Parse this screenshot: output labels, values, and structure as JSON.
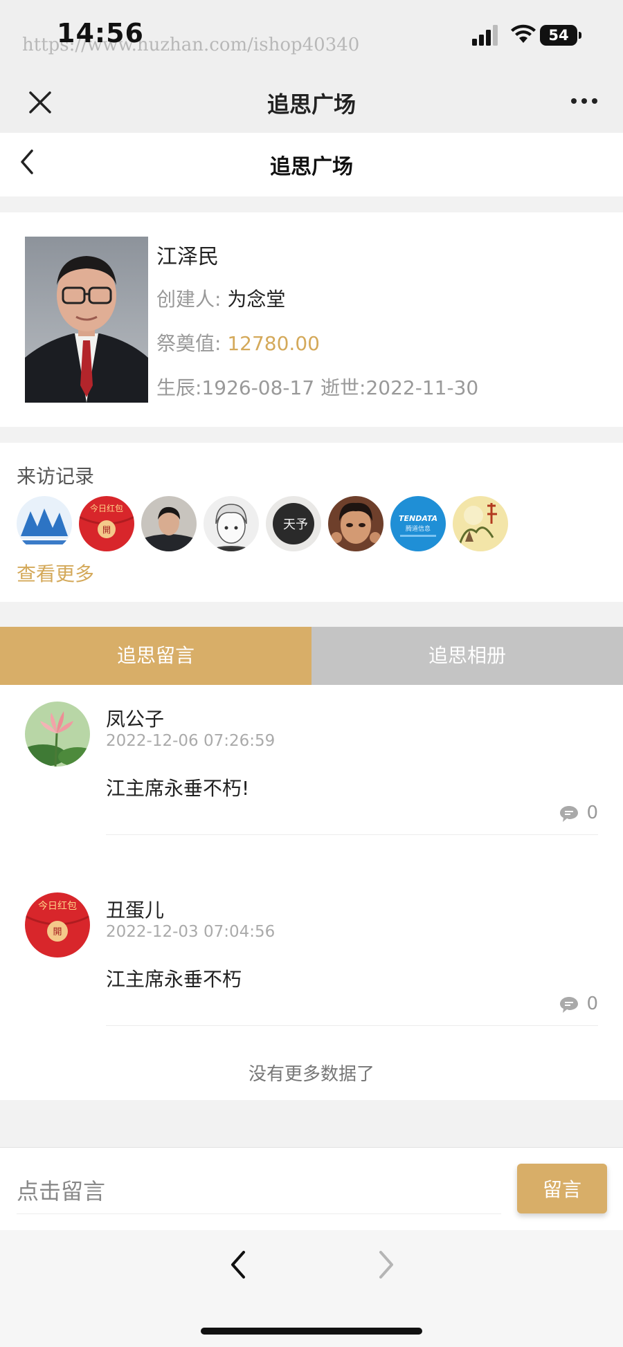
{
  "status_bar": {
    "time": "14:56",
    "watermark": "https://www.huzhan.com/ishop40340",
    "battery": "54"
  },
  "wechat_bar": {
    "title": "追思广场"
  },
  "page_nav": {
    "title": "追思广场"
  },
  "profile": {
    "name": "江泽民",
    "creator_label": "创建人:",
    "creator_value": "为念堂",
    "value_label": "祭奠值:",
    "value_amount": "12780.00",
    "dates": "生辰:1926-08-17 逝世:2022-11-30"
  },
  "visitors": {
    "title": "来访记录",
    "avatars": [
      {
        "icon": "visitor-avatar-blue-logo",
        "text": ""
      },
      {
        "icon": "visitor-avatar-red-envelope",
        "text": "今日红包",
        "badge": "開"
      },
      {
        "icon": "visitor-avatar-photo",
        "text": ""
      },
      {
        "icon": "visitor-avatar-sketch",
        "text": ""
      },
      {
        "icon": "visitor-avatar-calligraphy",
        "text": "天予"
      },
      {
        "icon": "visitor-avatar-photo",
        "text": ""
      },
      {
        "icon": "visitor-avatar-tendata",
        "text": "TENDATA",
        "subtext": "腾道信息"
      },
      {
        "icon": "visitor-avatar-painting",
        "text": ""
      }
    ],
    "see_more": "查看更多"
  },
  "tabs": {
    "messages": "追思留言",
    "album": "追思相册"
  },
  "messages": [
    {
      "name": "凤公子",
      "time": "2022-12-06 07:26:59",
      "text": "江主席永垂不朽!",
      "comments": "0",
      "avatar": "lotus-avatar"
    },
    {
      "name": "丑蛋儿",
      "time": "2022-12-03 07:04:56",
      "text": "江主席永垂不朽",
      "comments": "0",
      "avatar": "red-envelope-avatar",
      "avatar_text": "今日红包",
      "avatar_badge": "開"
    }
  ],
  "no_more": "没有更多数据了",
  "input": {
    "placeholder": "点击留言",
    "button": "留言"
  },
  "colors": {
    "accent": "#d8ae68",
    "gold_text": "#d4a95a",
    "tab_inactive": "#c4c4c4"
  }
}
